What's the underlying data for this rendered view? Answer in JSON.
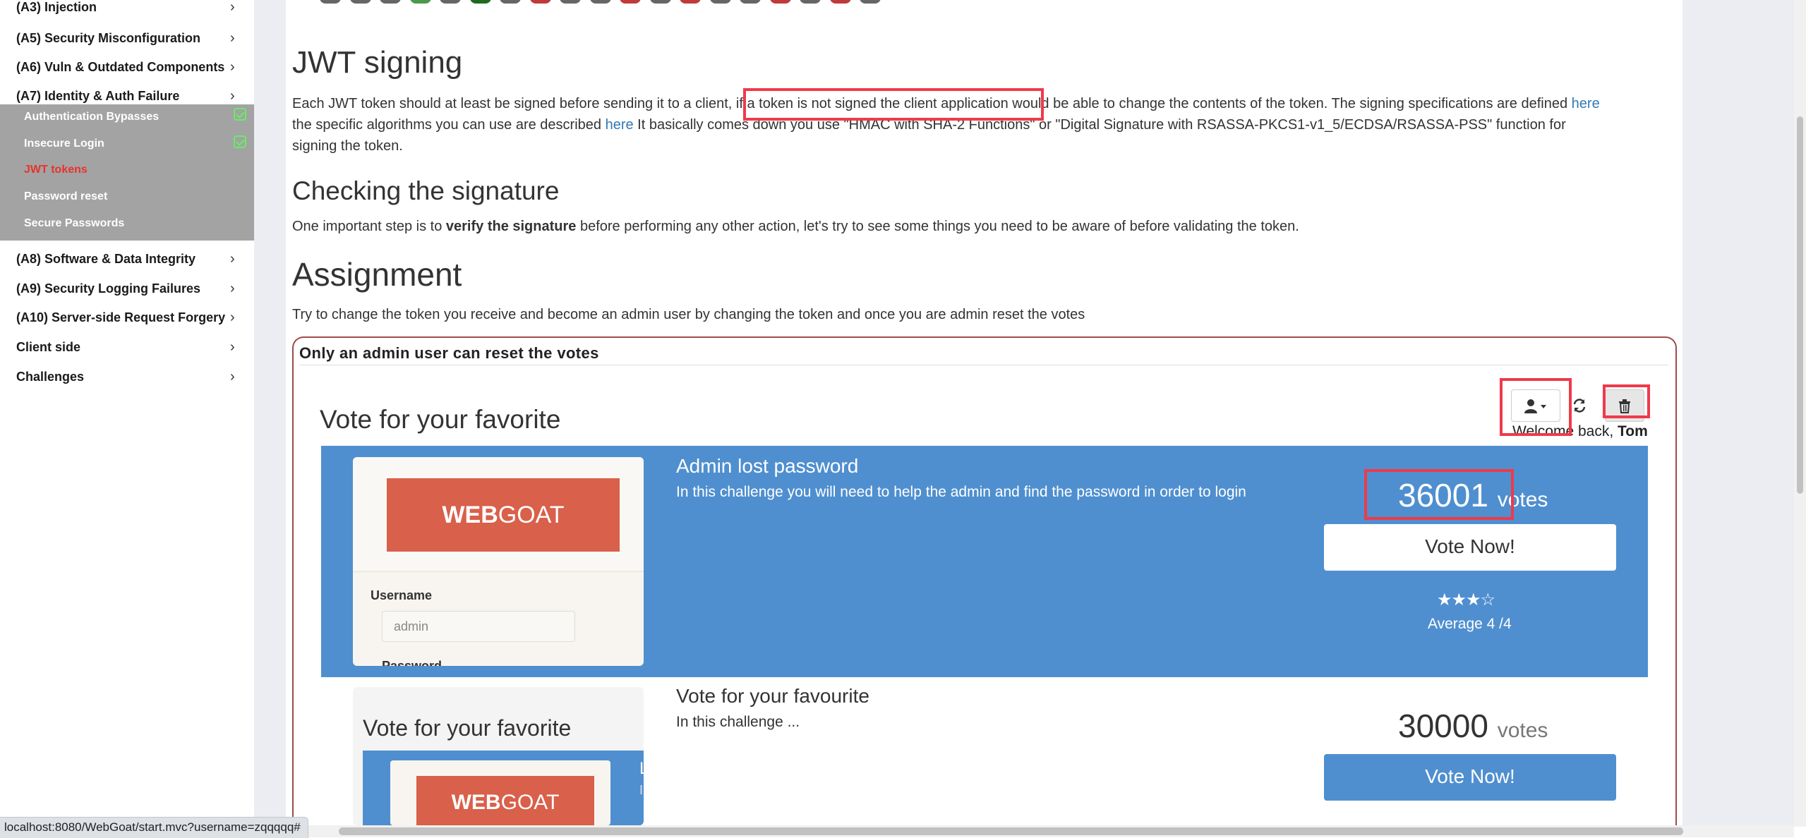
{
  "sidebar": {
    "items_top": [
      {
        "label": "(A3) Injection"
      },
      {
        "label": "(A5) Security Misconfiguration"
      },
      {
        "label": "(A6) Vuln & Outdated Components"
      },
      {
        "label": "(A7) Identity & Auth Failure"
      }
    ],
    "sub_items": [
      {
        "label": "Authentication Bypasses",
        "completed": true
      },
      {
        "label": "Insecure Login",
        "completed": true
      },
      {
        "label": "JWT tokens",
        "active": true
      },
      {
        "label": "Password reset"
      },
      {
        "label": "Secure Passwords"
      }
    ],
    "items_bottom": [
      {
        "label": "(A8) Software & Data Integrity"
      },
      {
        "label": "(A9) Security Logging Failures"
      },
      {
        "label": "(A10) Server-side Request Forgery"
      },
      {
        "label": "Client side"
      },
      {
        "label": "Challenges"
      }
    ],
    "chevron": "›"
  },
  "content": {
    "title": "JWT signing",
    "para1_a": "Each JWT token should at least be signed before sending it to a client, if a token is not signed the client application would be able to change the contents of the token. The signing specifications are defined ",
    "para1_link1": "here",
    "para2_a": "the specific algorithms you can use are described ",
    "para2_link2": "here",
    "para2_b": " It basically comes down you use \"HMAC with SHA-2 Functions\" or \"Digital Signature with RSASSA-PKCS1-v1_5/ECDSA/RSASSA-PSS\" function for",
    "para3": "signing the token.",
    "subtitle": "Checking the signature",
    "check_a": "One important step is to ",
    "check_bold": "verify the signature",
    "check_b": " before performing any other action, let's try to see some things you need to be aware of before validating the token.",
    "assignment_title": "Assignment",
    "assignment_text": "Try to change the token you receive and become an admin user by changing the token and once you are admin reset the votes"
  },
  "panel": {
    "title": "Only an admin user can reset the votes",
    "vote_heading": "Vote for your favorite",
    "welcome_prefix": "Welcome back, ",
    "welcome_user": "Tom",
    "icons": {
      "user": "user-icon",
      "refresh": "refresh-icon",
      "delete": "trash-icon"
    },
    "cards": [
      {
        "title": "Admin lost password",
        "description": "In this challenge you will need to help the admin and find the password in order to login",
        "votes": "36001",
        "votes_word": "votes",
        "vote_button": "Vote Now!",
        "rating_stars": "★★★☆",
        "rating_text": "Average 4 /4",
        "logo_text_bold": "WEB",
        "logo_text": "GOAT",
        "username_label": "Username",
        "username_placeholder": "admin",
        "password_label": "Password"
      },
      {
        "title": "Vote for your favourite",
        "description": "In this challenge ...",
        "votes": "30000",
        "votes_word": "votes",
        "vote_button": "Vote Now!",
        "inner_heading": "Vote for your favorite",
        "inner_letter1": "L",
        "inner_letter2": "I",
        "logo_text_bold": "WEB",
        "logo_text": "GOAT"
      }
    ]
  },
  "status_bar": {
    "url": "localhost:8080/WebGoat/start.mvc?username=zqqqqq#"
  },
  "colors": {
    "accent_blue": "#4f8fcf",
    "highlight_red": "#ef3a4b",
    "active_red": "#e8332c",
    "check_green": "#66ee66",
    "logo_red": "#d9604a"
  }
}
